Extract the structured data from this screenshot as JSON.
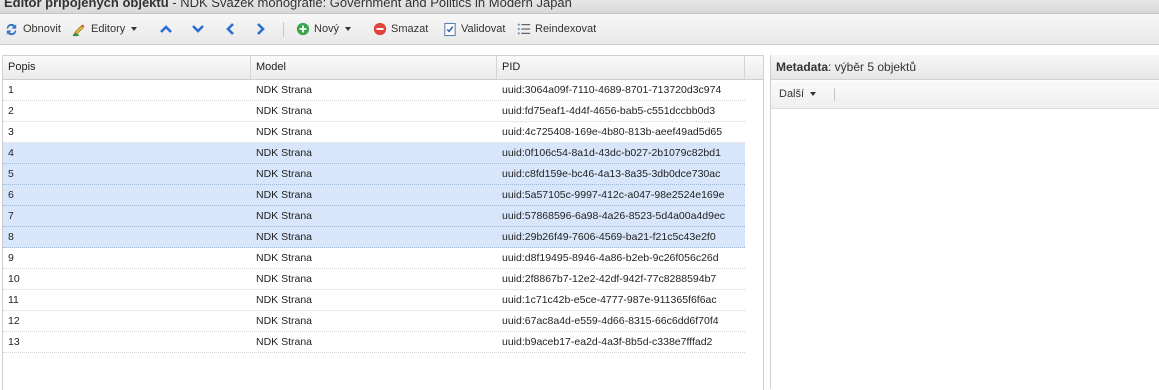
{
  "title": {
    "prefix": "Editor připojených objektů",
    "rest": " - NDK Svazek monografie: Government and Politics in Modern Japan"
  },
  "toolbar": {
    "refresh": "Obnovit",
    "editors": "Editory",
    "new": "Nový",
    "delete": "Smazat",
    "validate": "Validovat",
    "reindex": "Reindexovat"
  },
  "grid": {
    "columns": [
      "Popis",
      "Model",
      "PID"
    ],
    "rows": [
      {
        "popis": "1",
        "model": "NDK Strana",
        "pid": "uuid:3064a09f-7110-4689-8701-713720d3c974",
        "selected": false
      },
      {
        "popis": "2",
        "model": "NDK Strana",
        "pid": "uuid:fd75eaf1-4d4f-4656-bab5-c551dccbb0d3",
        "selected": false
      },
      {
        "popis": "3",
        "model": "NDK Strana",
        "pid": "uuid:4c725408-169e-4b80-813b-aeef49ad5d65",
        "selected": false
      },
      {
        "popis": "4",
        "model": "NDK Strana",
        "pid": "uuid:0f106c54-8a1d-43dc-b027-2b1079c82bd1",
        "selected": true
      },
      {
        "popis": "5",
        "model": "NDK Strana",
        "pid": "uuid:c8fd159e-bc46-4a13-8a35-3db0dce730ac",
        "selected": true
      },
      {
        "popis": "6",
        "model": "NDK Strana",
        "pid": "uuid:5a57105c-9997-412c-a047-98e2524e169e",
        "selected": true
      },
      {
        "popis": "7",
        "model": "NDK Strana",
        "pid": "uuid:57868596-6a98-4a26-8523-5d4a00a4d9ec",
        "selected": true
      },
      {
        "popis": "8",
        "model": "NDK Strana",
        "pid": "uuid:29b26f49-7606-4569-ba21-f21c5c43e2f0",
        "selected": true
      },
      {
        "popis": "9",
        "model": "NDK Strana",
        "pid": "uuid:d8f19495-8946-4a86-b2eb-9c26f056c26d",
        "selected": false
      },
      {
        "popis": "10",
        "model": "NDK Strana",
        "pid": "uuid:2f8867b7-12e2-42df-942f-77c8288594b7",
        "selected": false
      },
      {
        "popis": "11",
        "model": "NDK Strana",
        "pid": "uuid:1c71c42b-e5ce-4777-987e-911365f6f6ac",
        "selected": false
      },
      {
        "popis": "12",
        "model": "NDK Strana",
        "pid": "uuid:67ac8a4d-e559-4d66-8315-66c6dd6f70f4",
        "selected": false
      },
      {
        "popis": "13",
        "model": "NDK Strana",
        "pid": "uuid:b9aceb17-ea2d-4a3f-8b5d-c338e7fffad2",
        "selected": false
      }
    ]
  },
  "metadata": {
    "label": "Metadata",
    "selection": ": výběr 5 objektů",
    "more": "Další"
  },
  "colors": {
    "selected_row": "#d7e6fa",
    "nav_arrow": "#2a6fd8",
    "new_icon": "#3aa54a",
    "delete_icon": "#e0433c"
  }
}
